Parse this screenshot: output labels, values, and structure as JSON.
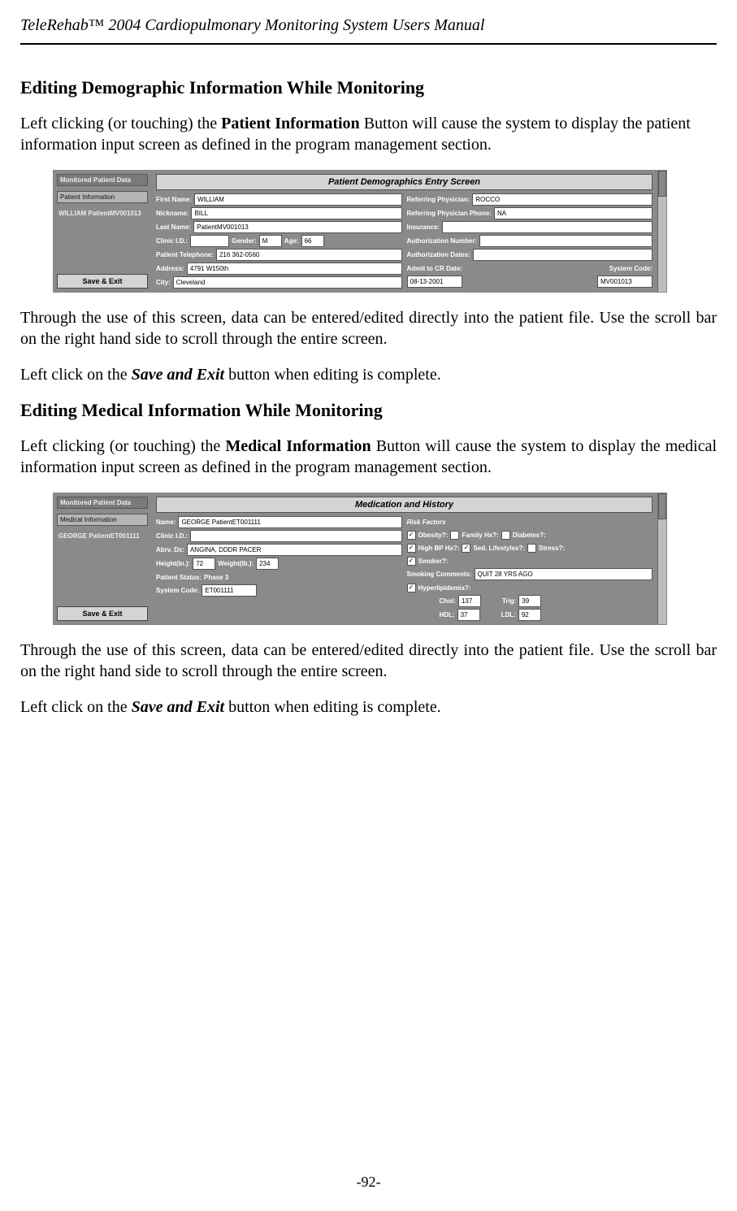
{
  "header": {
    "title_italic": "TeleRehab",
    "trademark": "™",
    "title_rest": " 2004 Cardiopulmonary Monitoring System Users Manual"
  },
  "section1": {
    "heading": "Editing Demographic Information While Monitoring",
    "p1a": "Left clicking (or touching) the ",
    "p1b": "Patient Information",
    "p1c": " Button will cause the system to display the patient information input screen as defined in the program management section.",
    "p2": "Through the use of this screen, data can be entered/edited directly into the patient file. Use the scroll bar on the right hand side to scroll through the entire screen.",
    "p3a": "Left click on the ",
    "p3b": "Save and Exit",
    "p3c": " button when editing is complete."
  },
  "section2": {
    "heading": "Editing Medical Information While Monitoring",
    "p1a": "Left clicking (or touching) the ",
    "p1b": "Medical Information",
    "p1c": " Button will cause the system to display the medical information input screen as defined in the program management section.",
    "p2": "Through the use of this screen, data can be entered/edited directly into the patient file. Use the scroll bar on the right hand side to scroll through the entire screen.",
    "p3a": "Left click on the ",
    "p3b": "Save and Exit",
    "p3c": " button when editing is complete."
  },
  "footer": {
    "page": "-92-"
  },
  "screenshot1": {
    "tab1": "Monitored Patient Data",
    "tab2": "Patient Information",
    "patient_label": "WILLIAM PatientMV001013",
    "save_exit": "Save & Exit",
    "title": "Patient Demographics Entry Screen",
    "left_col": {
      "first_name_l": "First Name:",
      "first_name_v": "WILLIAM",
      "nickname_l": "Nickname:",
      "nickname_v": "BILL",
      "last_name_l": "Last Name:",
      "last_name_v": "PatientMV001013",
      "clinic_l": "Clinic I.D.:",
      "clinic_v": "",
      "gender_l": "Gender:",
      "gender_v": "M",
      "age_l": "Age:",
      "age_v": "66",
      "phone_l": "Patient Telephone:",
      "phone_v": "216 362-0560",
      "address_l": "Address:",
      "address_v": "4791 W150th",
      "city_l": "City:",
      "city_v": "Cleveland"
    },
    "right_col": {
      "ref_phys_l": "Referring Physician:",
      "ref_phys_v": "ROCCO",
      "ref_phys_phone_l": "Referring Physician Phone:",
      "ref_phys_phone_v": "NA",
      "insurance_l": "Insurance:",
      "auth_num_l": "Authorization Number:",
      "auth_dates_l": "Authorization Dates:",
      "admit_l": "Admit to CR Date:",
      "admit_v": "08-13-2001",
      "syscode_l": "System Code:",
      "syscode_v": "MV001013"
    }
  },
  "screenshot2": {
    "tab1": "Monitored Patient Data",
    "tab2": "Medical Information",
    "patient_label": "GEORGE PatientET001111",
    "save_exit": "Save & Exit",
    "title": "Medication and History",
    "left_col": {
      "name_l": "Name:",
      "name_v": "GEORGE PatientET001111",
      "clinic_l": "Clinic I.D.:",
      "clinic_v": "",
      "abrv_l": "Abrv. Dx:",
      "abrv_v": "ANGINA, DDDR PACER",
      "height_l": "Height(In.):",
      "height_v": "72",
      "weight_l": "Weight(lb.):",
      "weight_v": "234",
      "status_l": "Patient Status:",
      "status_v": "Phase 3",
      "syscode_l": "System Code:",
      "syscode_v": "ET001111"
    },
    "right_col": {
      "risk_l": "Risk Factors",
      "obesity": "Obesity?:",
      "family": "Family Hx?:",
      "diabetes": "Diabetes?:",
      "highbp": "High BP Hx?:",
      "sed": "Sed. Lifestyles?:",
      "stress": "Stress?:",
      "smoker": "Smoker?:",
      "smoke_comm_l": "Smoking Comments:",
      "smoke_comm_v": "QUIT 28 YRS AGO",
      "hyper": "Hyperlipidemia?:",
      "chol_l": "Chol:",
      "chol_v": "137",
      "trig_l": "Trig:",
      "trig_v": "39",
      "hdl_l": "HDL:",
      "hdl_v": "37",
      "ldl_l": "LDL:",
      "ldl_v": "92",
      "check_on": "✓",
      "check_off": ""
    }
  }
}
